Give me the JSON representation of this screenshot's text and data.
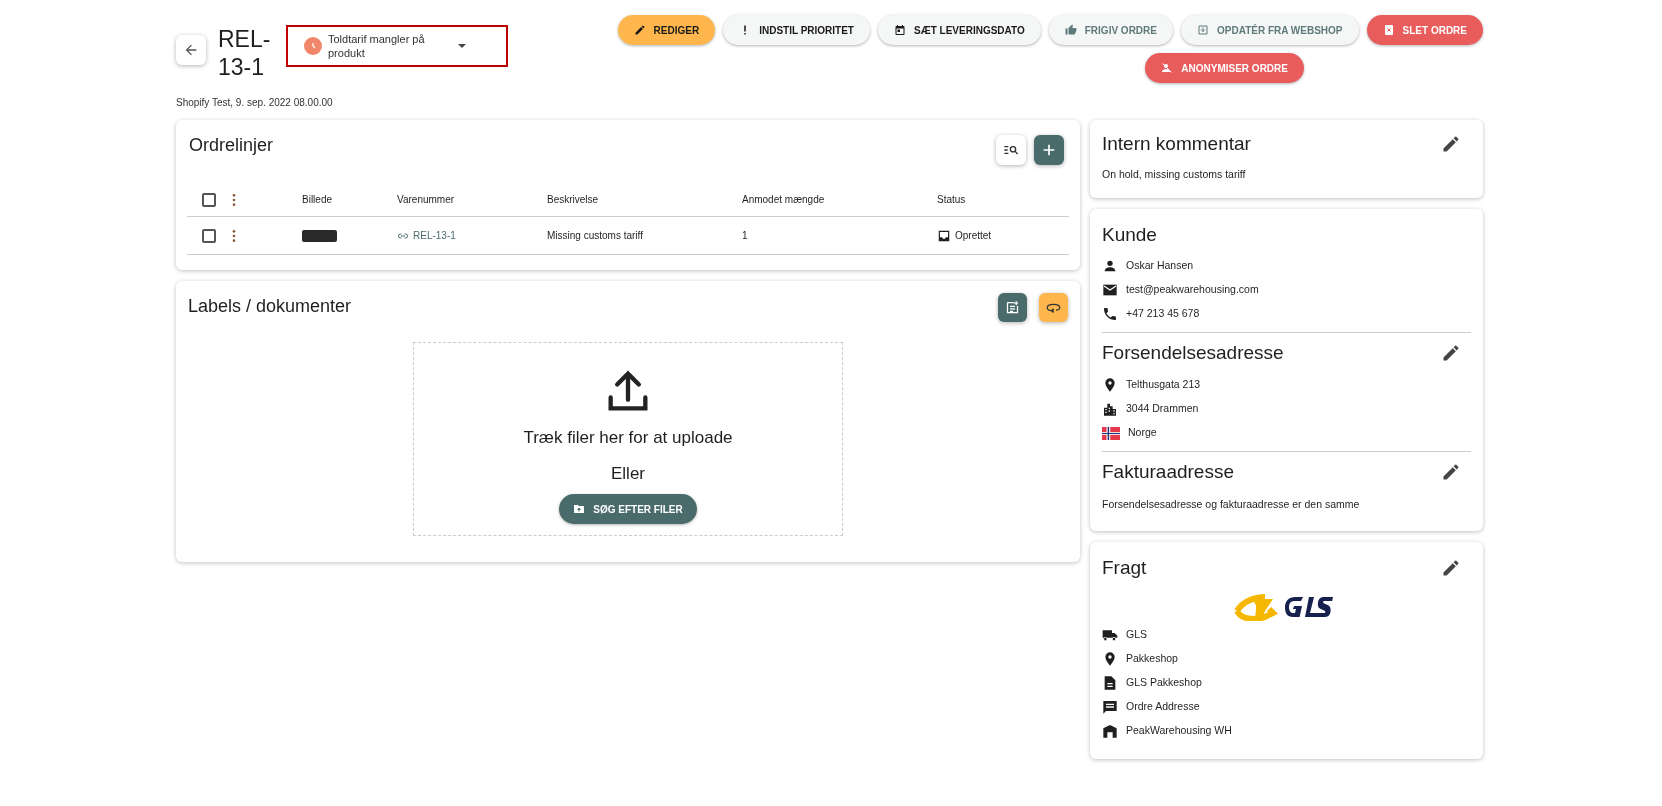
{
  "order": {
    "title": "REL-13-1",
    "status": "Toldtarif mangler på produkt",
    "source": "Shopify Test, 9. sep. 2022 08.00.00"
  },
  "actions": [
    {
      "label": "REDIGER",
      "kind": "primary",
      "disabled": false
    },
    {
      "label": "INDSTIL PRIORITET",
      "kind": "default",
      "disabled": false
    },
    {
      "label": "SÆT LEVERINGSDATO",
      "kind": "default",
      "disabled": false
    },
    {
      "label": "FRIGIV ORDRE",
      "kind": "default",
      "disabled": true
    },
    {
      "label": "OPDATÉR FRA WEBSHOP",
      "kind": "default",
      "disabled": true
    },
    {
      "label": "SLET ORDRE",
      "kind": "danger",
      "disabled": false
    },
    {
      "label": "ANONYMISER ORDRE",
      "kind": "danger",
      "disabled": false
    }
  ],
  "order_lines": {
    "title": "Ordrelinjer",
    "columns": [
      "Billede",
      "Varenummer",
      "Beskrivelse",
      "Anmodet mængde",
      "Status"
    ],
    "header_checked": false,
    "rows": [
      {
        "checked": false,
        "sku": "REL-13-1",
        "description": "Missing customs tariff",
        "quantity": "1",
        "status": "Oprettet"
      }
    ]
  },
  "documents": {
    "title": "Labels / dokumenter",
    "drop_text": "Træk filer her for at uploade",
    "or_text": "Eller",
    "browse": "SØG EFTER FILER"
  },
  "internal_comment": {
    "title": "Intern kommentar",
    "text": "On hold, missing customs tariff"
  },
  "customer": {
    "title": "Kunde",
    "name": "Oskar Hansen",
    "email": "test@peakwarehousing.com",
    "phone": "+47 213 45 678"
  },
  "shipping_address": {
    "title": "Forsendelsesadresse",
    "street": "Telthusgata 213",
    "city": "3044 Drammen",
    "country": "Norge"
  },
  "billing_address": {
    "title": "Fakturaadresse",
    "text": "Forsendelsesadresse og fakturaadresse er den samme"
  },
  "freight": {
    "title": "Fragt",
    "carrier": "GLS",
    "method": "Pakkeshop",
    "product": "GLS Pakkeshop",
    "address": "Ordre Addresse",
    "warehouse": "PeakWarehousing WH"
  }
}
